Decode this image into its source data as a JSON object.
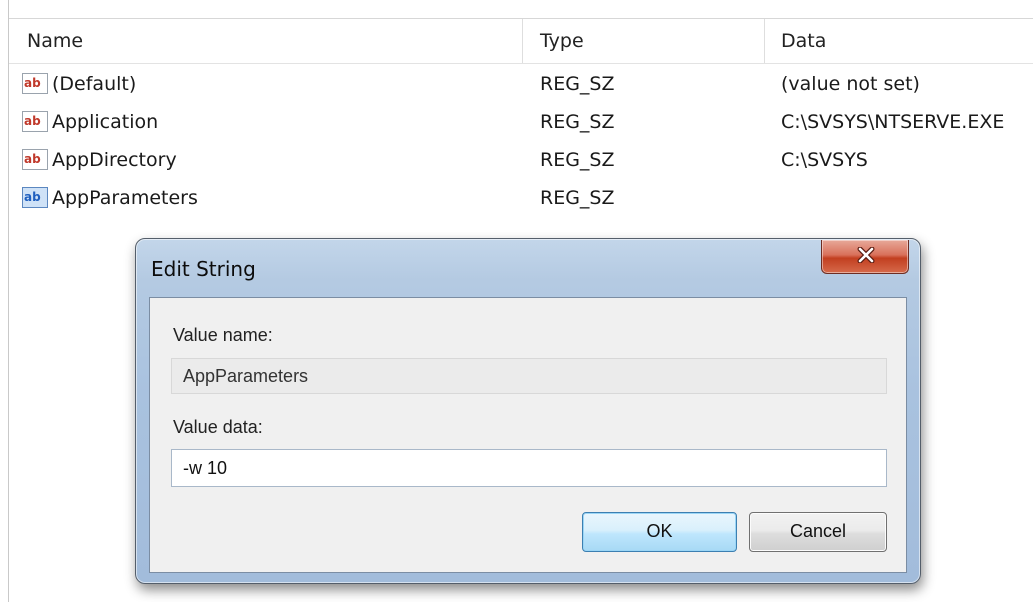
{
  "listview": {
    "columns": {
      "name": "Name",
      "type": "Type",
      "data": "Data"
    },
    "rows": [
      {
        "icon": "string-value-icon",
        "name": "(Default)",
        "type": "REG_SZ",
        "data": "(value not set)"
      },
      {
        "icon": "string-value-icon",
        "name": "Application",
        "type": "REG_SZ",
        "data": "C:\\SVSYS\\NTSERVE.EXE"
      },
      {
        "icon": "string-value-icon",
        "name": "AppDirectory",
        "type": "REG_SZ",
        "data": "C:\\SVSYS"
      },
      {
        "icon": "string-value-icon-selected",
        "name": "AppParameters",
        "type": "REG_SZ",
        "data": ""
      }
    ]
  },
  "dialog": {
    "title": "Edit String",
    "close_icon": "close-icon",
    "value_name_label": "Value name:",
    "value_name": "AppParameters",
    "value_data_label": "Value data:",
    "value_data": "-w 10",
    "ok_label": "OK",
    "cancel_label": "Cancel"
  },
  "colors": {
    "icon_text": "#c0392b",
    "icon_text_selected": "#1f5fbf",
    "ok_border": "#3c7fb1",
    "close_red": "#c23f20"
  }
}
